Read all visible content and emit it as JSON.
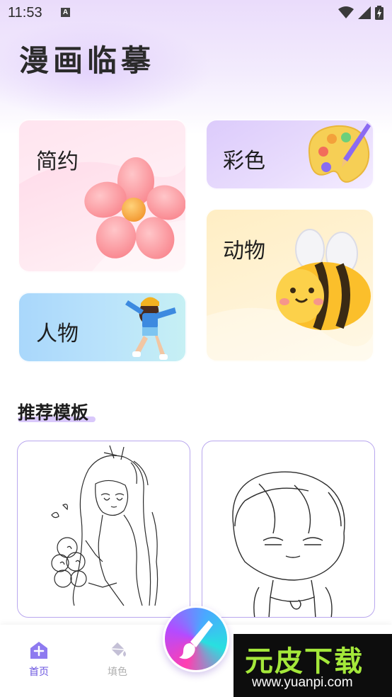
{
  "status_bar": {
    "time": "11:53",
    "notification_icon": "a-icon",
    "icons": [
      "wifi-icon",
      "signal-icon",
      "battery-charging-icon"
    ]
  },
  "app": {
    "title": "漫画临摹"
  },
  "categories": {
    "simple": {
      "label": "简约",
      "icon": "flower-icon",
      "color": "#ffd6e7"
    },
    "color": {
      "label": "彩色",
      "icon": "palette-icon",
      "color": "#dccbfb"
    },
    "animal": {
      "label": "动物",
      "icon": "bee-icon",
      "color": "#ffeec4"
    },
    "people": {
      "label": "人物",
      "icon": "girl-figure-icon",
      "color": "#a9d7fb"
    }
  },
  "recommended": {
    "title": "推荐模板",
    "templates": [
      {
        "icon": "anime-girl-sketch"
      },
      {
        "icon": "chibi-boy-sketch"
      }
    ]
  },
  "bottom_nav": {
    "items": [
      {
        "label": "首页",
        "icon": "home-plus-icon",
        "active": true
      },
      {
        "label": "填色",
        "icon": "paint-bucket-icon",
        "active": false
      }
    ],
    "fab_icon": "brush-icon"
  },
  "watermark": {
    "main": "元皮下载",
    "sub": "www.yuanpi.com"
  },
  "colors": {
    "accent": "#6b55e0",
    "template_border": "#b9a7ee"
  }
}
